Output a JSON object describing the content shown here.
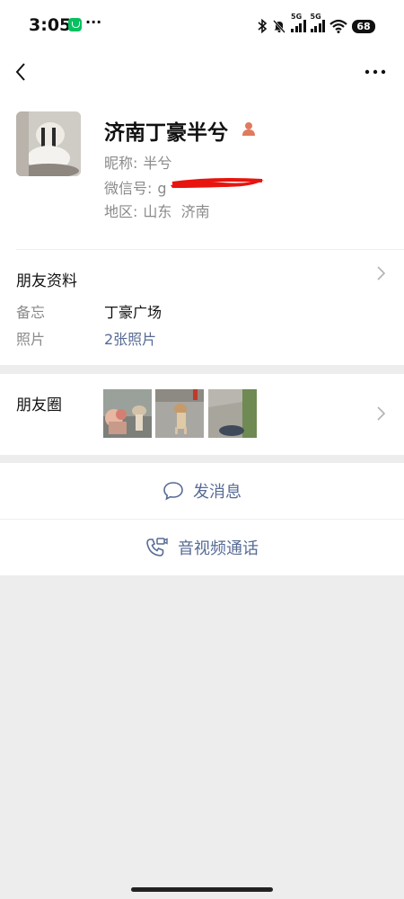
{
  "status_bar": {
    "time": "3:05",
    "dots": "···",
    "signal1_label": "5G",
    "signal2_label": "5G",
    "battery": "68"
  },
  "profile": {
    "name": "济南丁豪半兮",
    "nickname_label": "昵称:",
    "nickname": "半兮",
    "wechat_id_label": "微信号:",
    "wechat_id_visible": "g",
    "region_label": "地区:",
    "region": "山东  济南"
  },
  "friend_info": {
    "title": "朋友资料",
    "remark_label": "备忘",
    "remark_value": "丁豪广场",
    "photos_label": "照片",
    "photos_value": "2张照片"
  },
  "moments": {
    "title": "朋友圈"
  },
  "actions": {
    "message": "发消息",
    "call": "音视频通话"
  },
  "colors": {
    "link": "#576b95",
    "background": "#ededed",
    "brand_green": "#07c160"
  }
}
